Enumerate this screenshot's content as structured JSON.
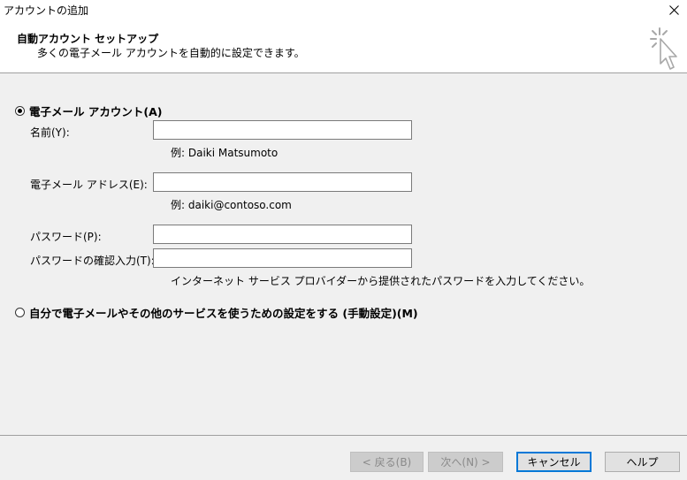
{
  "window": {
    "title": "アカウントの追加",
    "close_icon": "close-icon"
  },
  "header": {
    "title": "自動アカウント セットアップ",
    "subtitle": "多くの電子メール アカウントを自動的に設定できます。",
    "icon": "cursor-sparkle-icon"
  },
  "options": {
    "email_account": {
      "label": "電子メール アカウント(A)",
      "selected": true
    },
    "manual": {
      "label": "自分で電子メールやその他のサービスを使うための設定をする (手動設定)(M)",
      "selected": false
    }
  },
  "form": {
    "name": {
      "label": "名前(Y):",
      "value": "",
      "hint": "例: Daiki Matsumoto"
    },
    "email": {
      "label": "電子メール アドレス(E):",
      "value": "",
      "hint": "例: daiki@contoso.com"
    },
    "password": {
      "label": "パスワード(P):",
      "value": ""
    },
    "password_confirm": {
      "label": "パスワードの確認入力(T):",
      "value": "",
      "hint": "インターネット サービス プロバイダーから提供されたパスワードを入力してください。"
    }
  },
  "buttons": {
    "back": "< 戻る(B)",
    "next": "次へ(N) >",
    "cancel": "キャンセル",
    "help": "ヘルプ"
  }
}
